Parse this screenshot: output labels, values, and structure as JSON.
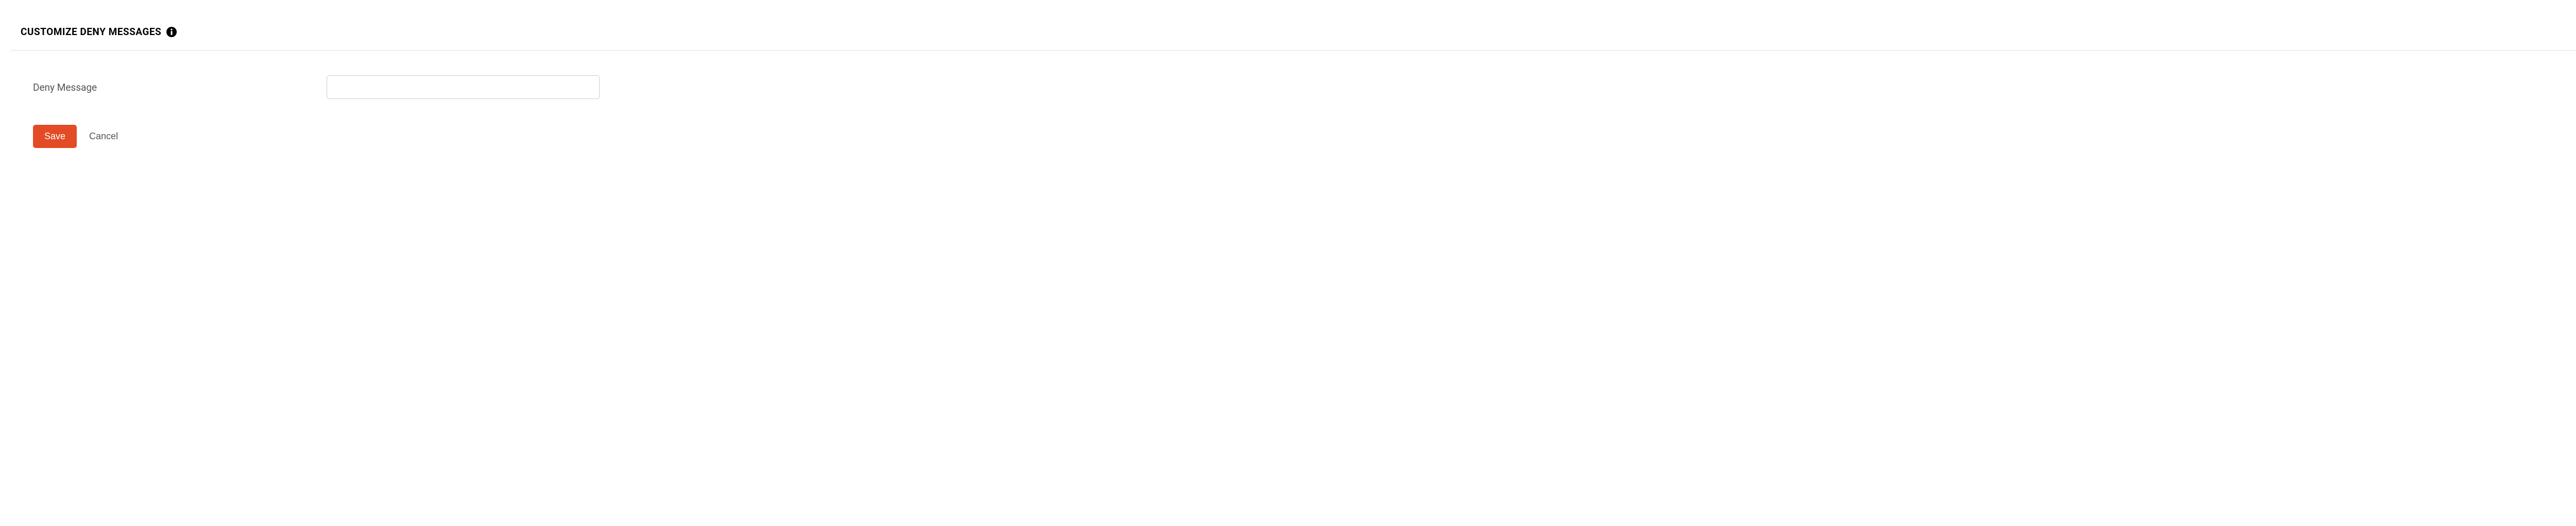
{
  "header": {
    "title": "CUSTOMIZE DENY MESSAGES"
  },
  "form": {
    "deny_message_label": "Deny Message",
    "deny_message_value": ""
  },
  "buttons": {
    "save": "Save",
    "cancel": "Cancel"
  }
}
